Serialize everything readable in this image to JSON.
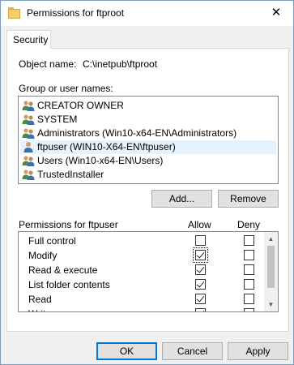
{
  "window": {
    "title": "Permissions for ftproot",
    "close_glyph": "✕"
  },
  "tabs": [
    {
      "label": "Security"
    }
  ],
  "object": {
    "label": "Object name:",
    "value": "C:\\inetpub\\ftproot"
  },
  "groups": {
    "label": "Group or user names:",
    "items": [
      {
        "name": "CREATOR OWNER",
        "icon": "group-users-icon"
      },
      {
        "name": "SYSTEM",
        "icon": "group-users-icon"
      },
      {
        "name": "Administrators (Win10-x64-EN\\Administrators)",
        "icon": "group-users-icon"
      },
      {
        "name": "ftpuser (WIN10-X64-EN\\ftpuser)",
        "icon": "single-user-icon",
        "selected": true
      },
      {
        "name": "Users (Win10-x64-EN\\Users)",
        "icon": "group-users-icon"
      },
      {
        "name": "TrustedInstaller",
        "icon": "group-users-icon"
      }
    ],
    "add_label": "Add...",
    "remove_label": "Remove"
  },
  "permissions": {
    "title": "Permissions for ftpuser",
    "allow_header": "Allow",
    "deny_header": "Deny",
    "rows": [
      {
        "name": "Full control",
        "allow": false,
        "deny": false
      },
      {
        "name": "Modify",
        "allow": true,
        "deny": false,
        "focused": true
      },
      {
        "name": "Read & execute",
        "allow": true,
        "deny": false
      },
      {
        "name": "List folder contents",
        "allow": true,
        "deny": false
      },
      {
        "name": "Read",
        "allow": true,
        "deny": false
      },
      {
        "name": "Write",
        "allow": true,
        "deny": false
      }
    ]
  },
  "footer": {
    "ok_label": "OK",
    "cancel_label": "Cancel",
    "apply_label": "Apply"
  }
}
